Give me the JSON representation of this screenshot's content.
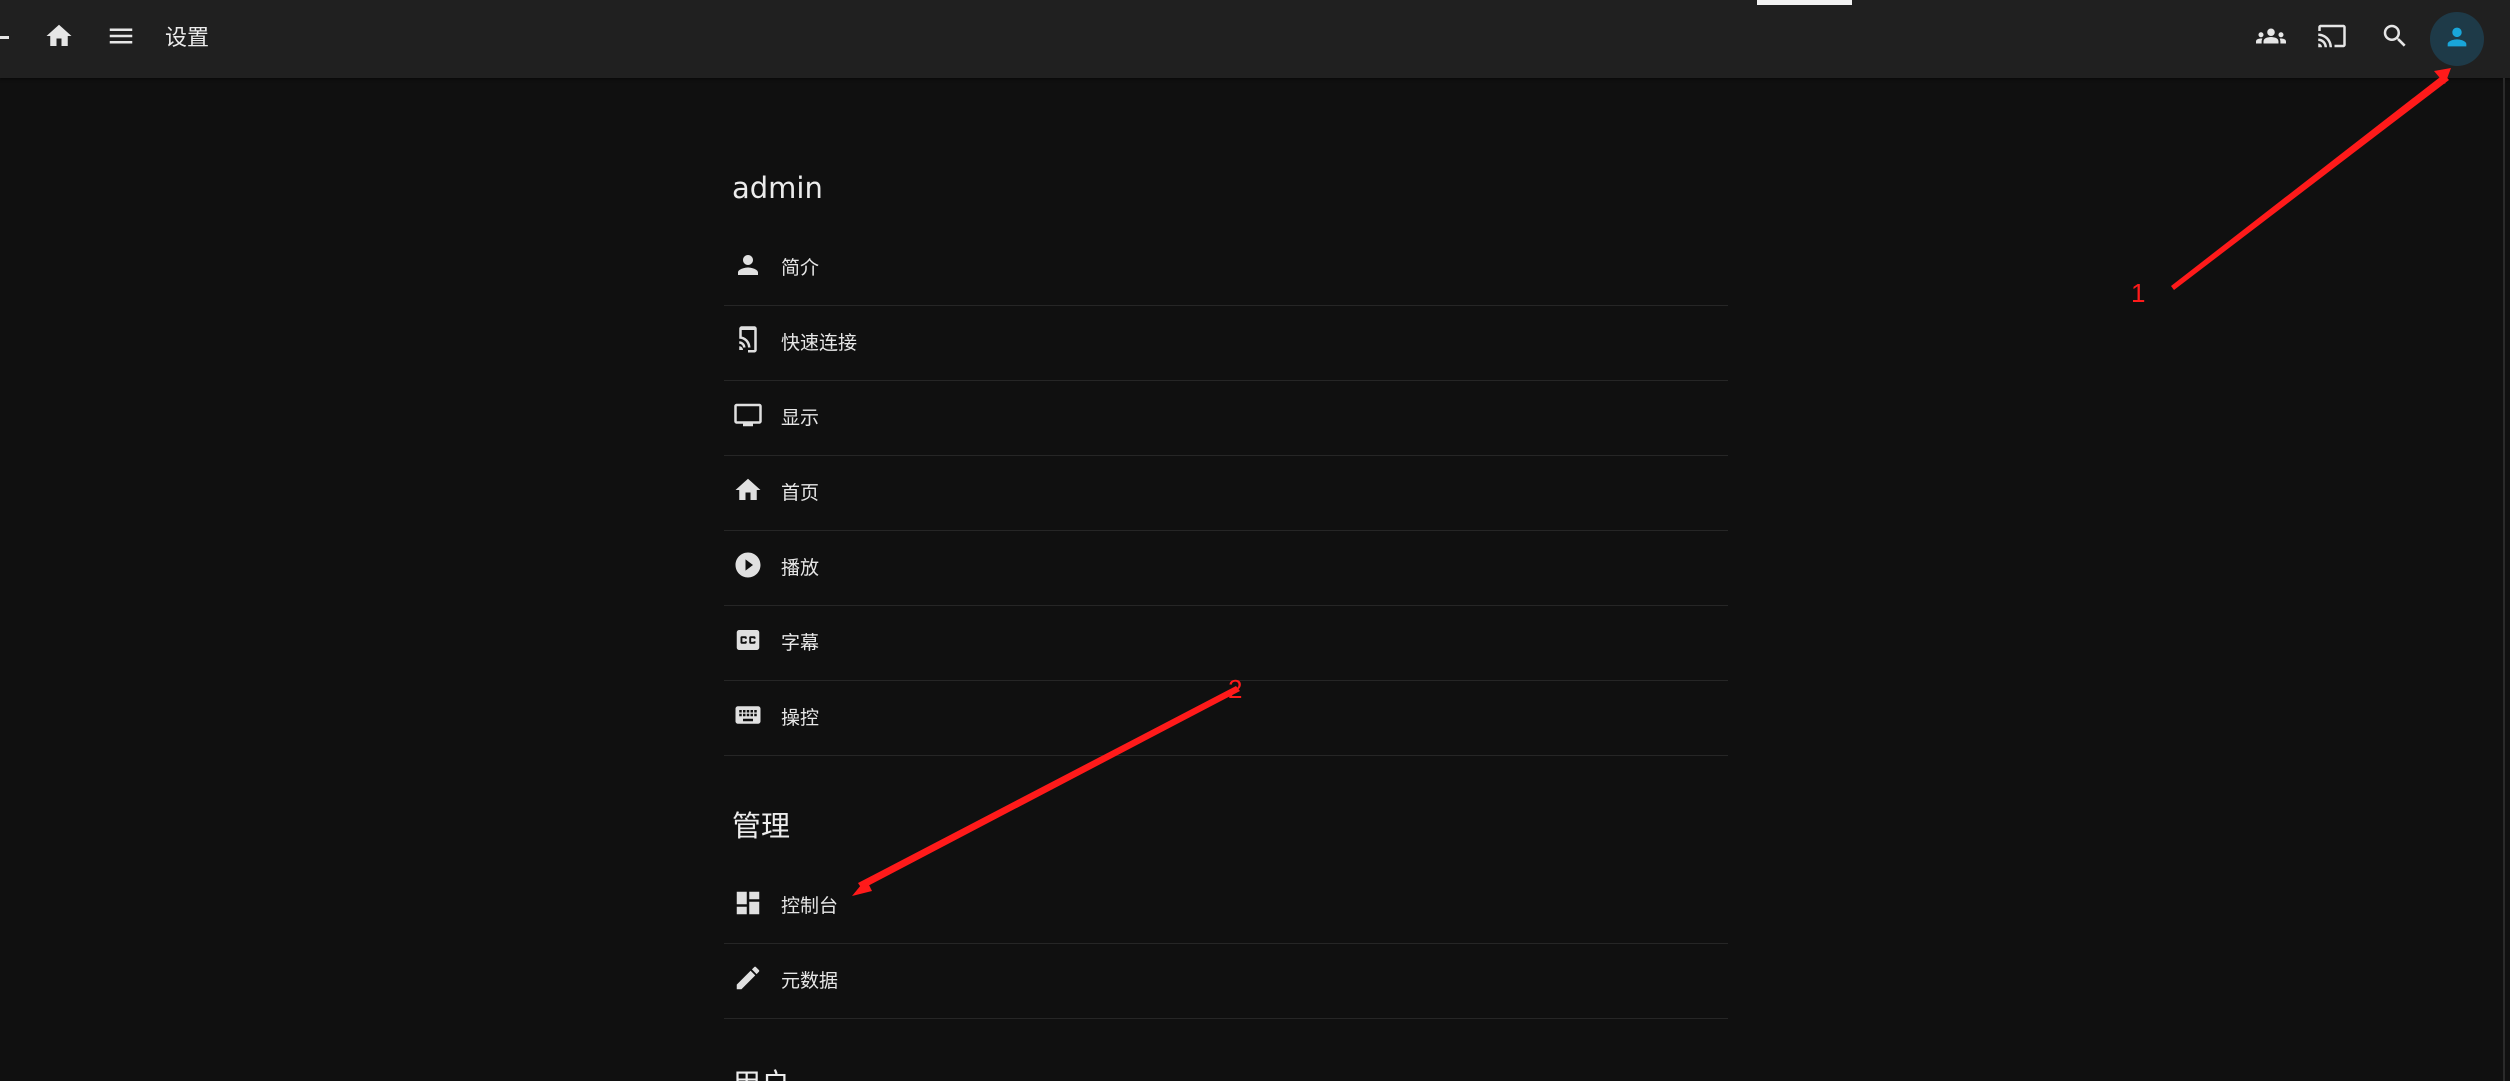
{
  "header": {
    "title": "设置",
    "icons": {
      "home": "home-icon",
      "menu": "menu-icon",
      "sync_play": "group-icon",
      "cast": "cast-icon",
      "search": "search-icon",
      "user": "user-icon"
    },
    "user_accent": "#19a6da"
  },
  "sections": {
    "user": {
      "title": "admin",
      "items": [
        {
          "label": "简介",
          "icon": "person-icon"
        },
        {
          "label": "快速连接",
          "icon": "phonelink-icon"
        },
        {
          "label": "显示",
          "icon": "monitor-icon"
        },
        {
          "label": "首页",
          "icon": "home-icon"
        },
        {
          "label": "播放",
          "icon": "play-circle-icon"
        },
        {
          "label": "字幕",
          "icon": "closed-caption-icon"
        },
        {
          "label": "操控",
          "icon": "keyboard-icon"
        }
      ]
    },
    "admin": {
      "title": "管理",
      "items": [
        {
          "label": "控制台",
          "icon": "dashboard-icon"
        },
        {
          "label": "元数据",
          "icon": "edit-icon"
        }
      ]
    },
    "next_section_partial": "用户"
  },
  "annotations": {
    "color": "#ff1a1a",
    "labels": [
      "1",
      "2"
    ]
  }
}
